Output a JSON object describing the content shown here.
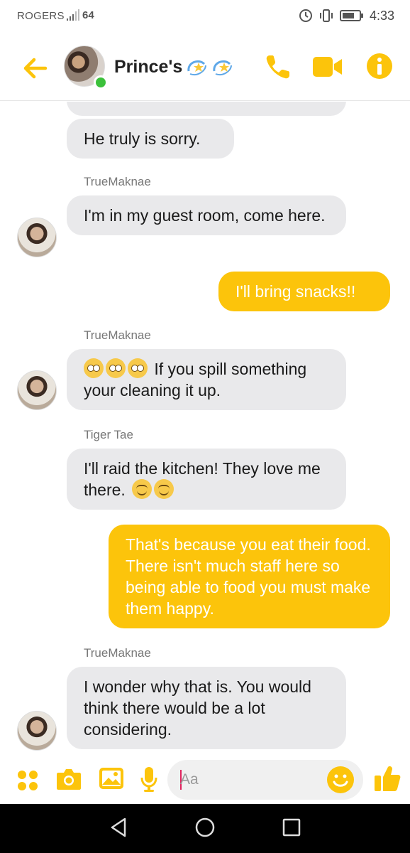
{
  "status_bar": {
    "carrier": "ROGERS",
    "signal_text": "64",
    "time": "4:33"
  },
  "header": {
    "title": "Prince's",
    "title_emoji": [
      "dizzy-star-icon",
      "dizzy-star-icon"
    ],
    "accent_color": "#fcc40b"
  },
  "messages": [
    {
      "direction": "in",
      "text": "He truly is sorry."
    },
    {
      "sender": "TrueMaknae",
      "direction": "in",
      "text": "I'm in my guest room, come here."
    },
    {
      "direction": "out",
      "text": "I'll bring snacks!!"
    },
    {
      "sender": "TrueMaknae",
      "direction": "in",
      "emoji_prefix": [
        "face-with-rolling-eyes",
        "face-with-rolling-eyes",
        "face-with-rolling-eyes"
      ],
      "text": "If you spill something your cleaning it up."
    },
    {
      "sender": "Tiger Tae",
      "direction": "in",
      "text": "I'll raid the kitchen! They love me there.",
      "emoji_suffix": [
        "smiling-face",
        "smiling-face"
      ]
    },
    {
      "direction": "out",
      "text": "That's because you eat their food. There isn't much staff here so being able to food you must make them happy."
    },
    {
      "sender": "TrueMaknae",
      "direction": "in",
      "text": "I wonder why that is. You would think there would be a lot considering."
    }
  ],
  "composer": {
    "placeholder": "Aa"
  },
  "colors": {
    "incoming_bubble": "#e9e9eb",
    "outgoing_bubble": "#fcc40b",
    "online": "#3cc13b"
  }
}
